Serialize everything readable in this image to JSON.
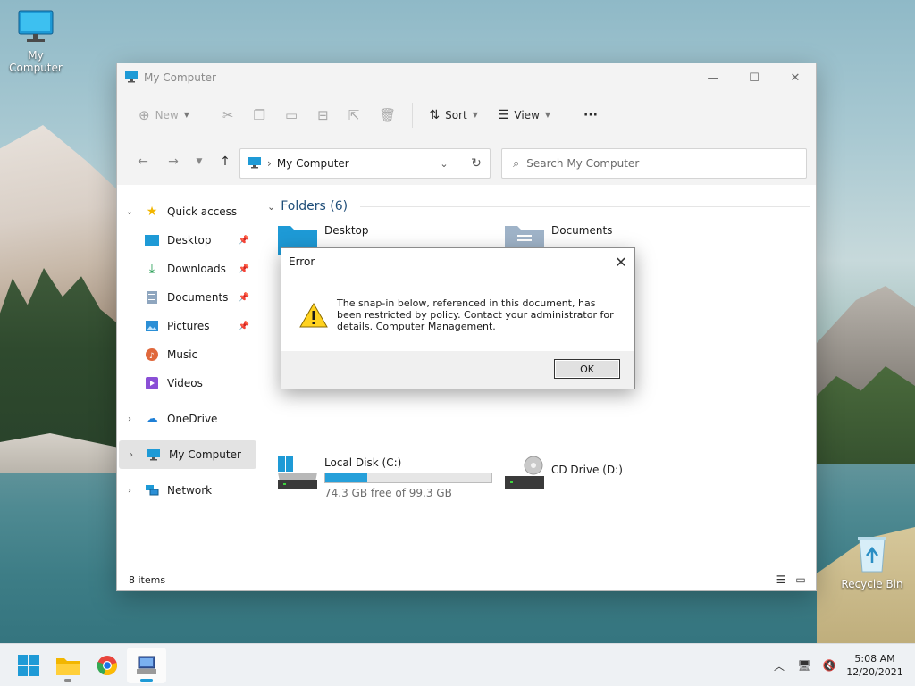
{
  "desktop": {
    "icons": [
      {
        "label": "My Computer"
      },
      {
        "label": "Recycle Bin"
      }
    ]
  },
  "window": {
    "title": "My Computer",
    "controls": {
      "minimize": "—",
      "maximize": "☐",
      "close": "✕"
    }
  },
  "commandbar": {
    "new_label": "New",
    "sort_label": "Sort",
    "view_label": "View",
    "more_label": "···"
  },
  "navigation": {
    "address_text": "My Computer",
    "search_placeholder": "Search My Computer"
  },
  "sidebar": {
    "quick_access": "Quick access",
    "items": [
      {
        "label": "Desktop",
        "pinned": true
      },
      {
        "label": "Downloads",
        "pinned": true
      },
      {
        "label": "Documents",
        "pinned": true
      },
      {
        "label": "Pictures",
        "pinned": true
      },
      {
        "label": "Music",
        "pinned": false
      },
      {
        "label": "Videos",
        "pinned": false
      }
    ],
    "onedrive": "OneDrive",
    "my_computer": "My Computer",
    "network": "Network"
  },
  "content": {
    "folders_header": "Folders (6)",
    "folders": [
      {
        "label": "Desktop"
      },
      {
        "label": "Documents"
      }
    ],
    "drives": [
      {
        "label": "Local Disk (C:)",
        "detail": "74.3 GB free of 99.3 GB",
        "used_fraction": 0.25
      },
      {
        "label": "CD Drive (D:)"
      }
    ]
  },
  "status": {
    "item_count": "8 items"
  },
  "dialog": {
    "title": "Error",
    "message": "The snap-in below, referenced in this document, has been restricted by policy. Contact your administrator for details. Computer Management.",
    "ok_label": "OK",
    "close_glyph": "✕"
  },
  "taskbar": {
    "time": "5:08 AM",
    "date": "12/20/2021"
  },
  "colors": {
    "accent": "#26a0da",
    "folder_blue": "#1f4e79",
    "taskbar_bg": "#eef1f4"
  }
}
